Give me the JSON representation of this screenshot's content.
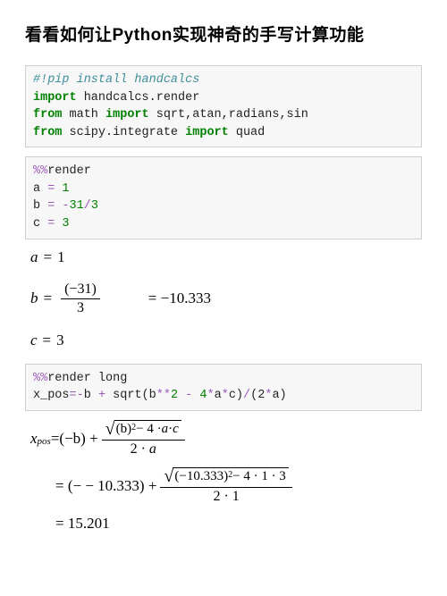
{
  "title": "看看如何让Python实现神奇的手写计算功能",
  "cell1": {
    "comment": "#!pip install handcalcs",
    "l1a": "import",
    "l1b": " handcalcs.render",
    "l2a": "from",
    "l2b": " math ",
    "l2c": "import",
    "l2d": " sqrt,atan,radians,sin",
    "l3a": "from",
    "l3b": " scipy.integrate ",
    "l3c": "import",
    "l3d": " quad"
  },
  "cell2": {
    "magic": "%%",
    "magic2": "render",
    "aL": "a ",
    "aOp": "=",
    "aR": " 1",
    "bL": "b ",
    "bOp": "=",
    "bNeg": " -",
    "bNum1": "31",
    "bSl": "/",
    "bNum2": "3",
    "cL": "c ",
    "cOp": "=",
    "cR": " 3"
  },
  "math1": {
    "a_lhs": "a",
    "a_eq": "=",
    "a_rhs": "1",
    "b_lhs": "b",
    "b_eq": "=",
    "b_num": "(−31)",
    "b_den": "3",
    "b_eq2": "= −10.333",
    "c_lhs": "c",
    "c_eq": "=",
    "c_rhs": "3"
  },
  "cell3": {
    "magic": "%%",
    "magic2": "render long",
    "lhs": "x_pos",
    "op": "=",
    "neg": "-",
    "expr1": "b ",
    "plus": "+",
    "expr2": " sqrt(b",
    "star1": "**",
    "two": "2 ",
    "minus": "-",
    "four": " 4",
    "star2": "*",
    "aa": "a",
    "star3": "*",
    "cc": "c)",
    "sl": "/",
    "lp": "(2",
    "star4": "*",
    "ar": "a)"
  },
  "math2": {
    "x": "x",
    "pos": "pos",
    "eq": " = ",
    "t1": "(−b) + ",
    "sq_in1": "(b)",
    "sq_exp1": "2",
    "sq_mid1": " − 4 · ",
    "sq_a1": "a",
    "sq_dot1": " · ",
    "sq_c1": "c",
    "den1": "2 · ",
    "den1a": "a",
    "t2": "= (− − 10.333) + ",
    "sq_in2": "(−10.333)",
    "sq_exp2": "2",
    "sq_mid2": " − 4 · 1 · 3",
    "den2": "2 · 1",
    "t3": "= 15.201"
  }
}
